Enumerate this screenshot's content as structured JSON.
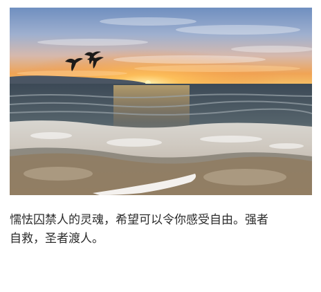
{
  "photo": {
    "subject": "sunset-over-ocean-with-birds",
    "colors": {
      "sky_top": "#7f9cc7",
      "sky_mid": "#c9b7b5",
      "horizon_glow": "#f1a24a",
      "sun": "#ffdf7a",
      "sea_dark": "#3c4b57",
      "foam": "#f4f1ee",
      "sand": "#9a8063"
    },
    "birds_count": 3
  },
  "caption": {
    "line1": "懦怯囚禁人的灵魂，希望可以令你感受自由。强者",
    "line2": "自救，圣者渡人。"
  }
}
